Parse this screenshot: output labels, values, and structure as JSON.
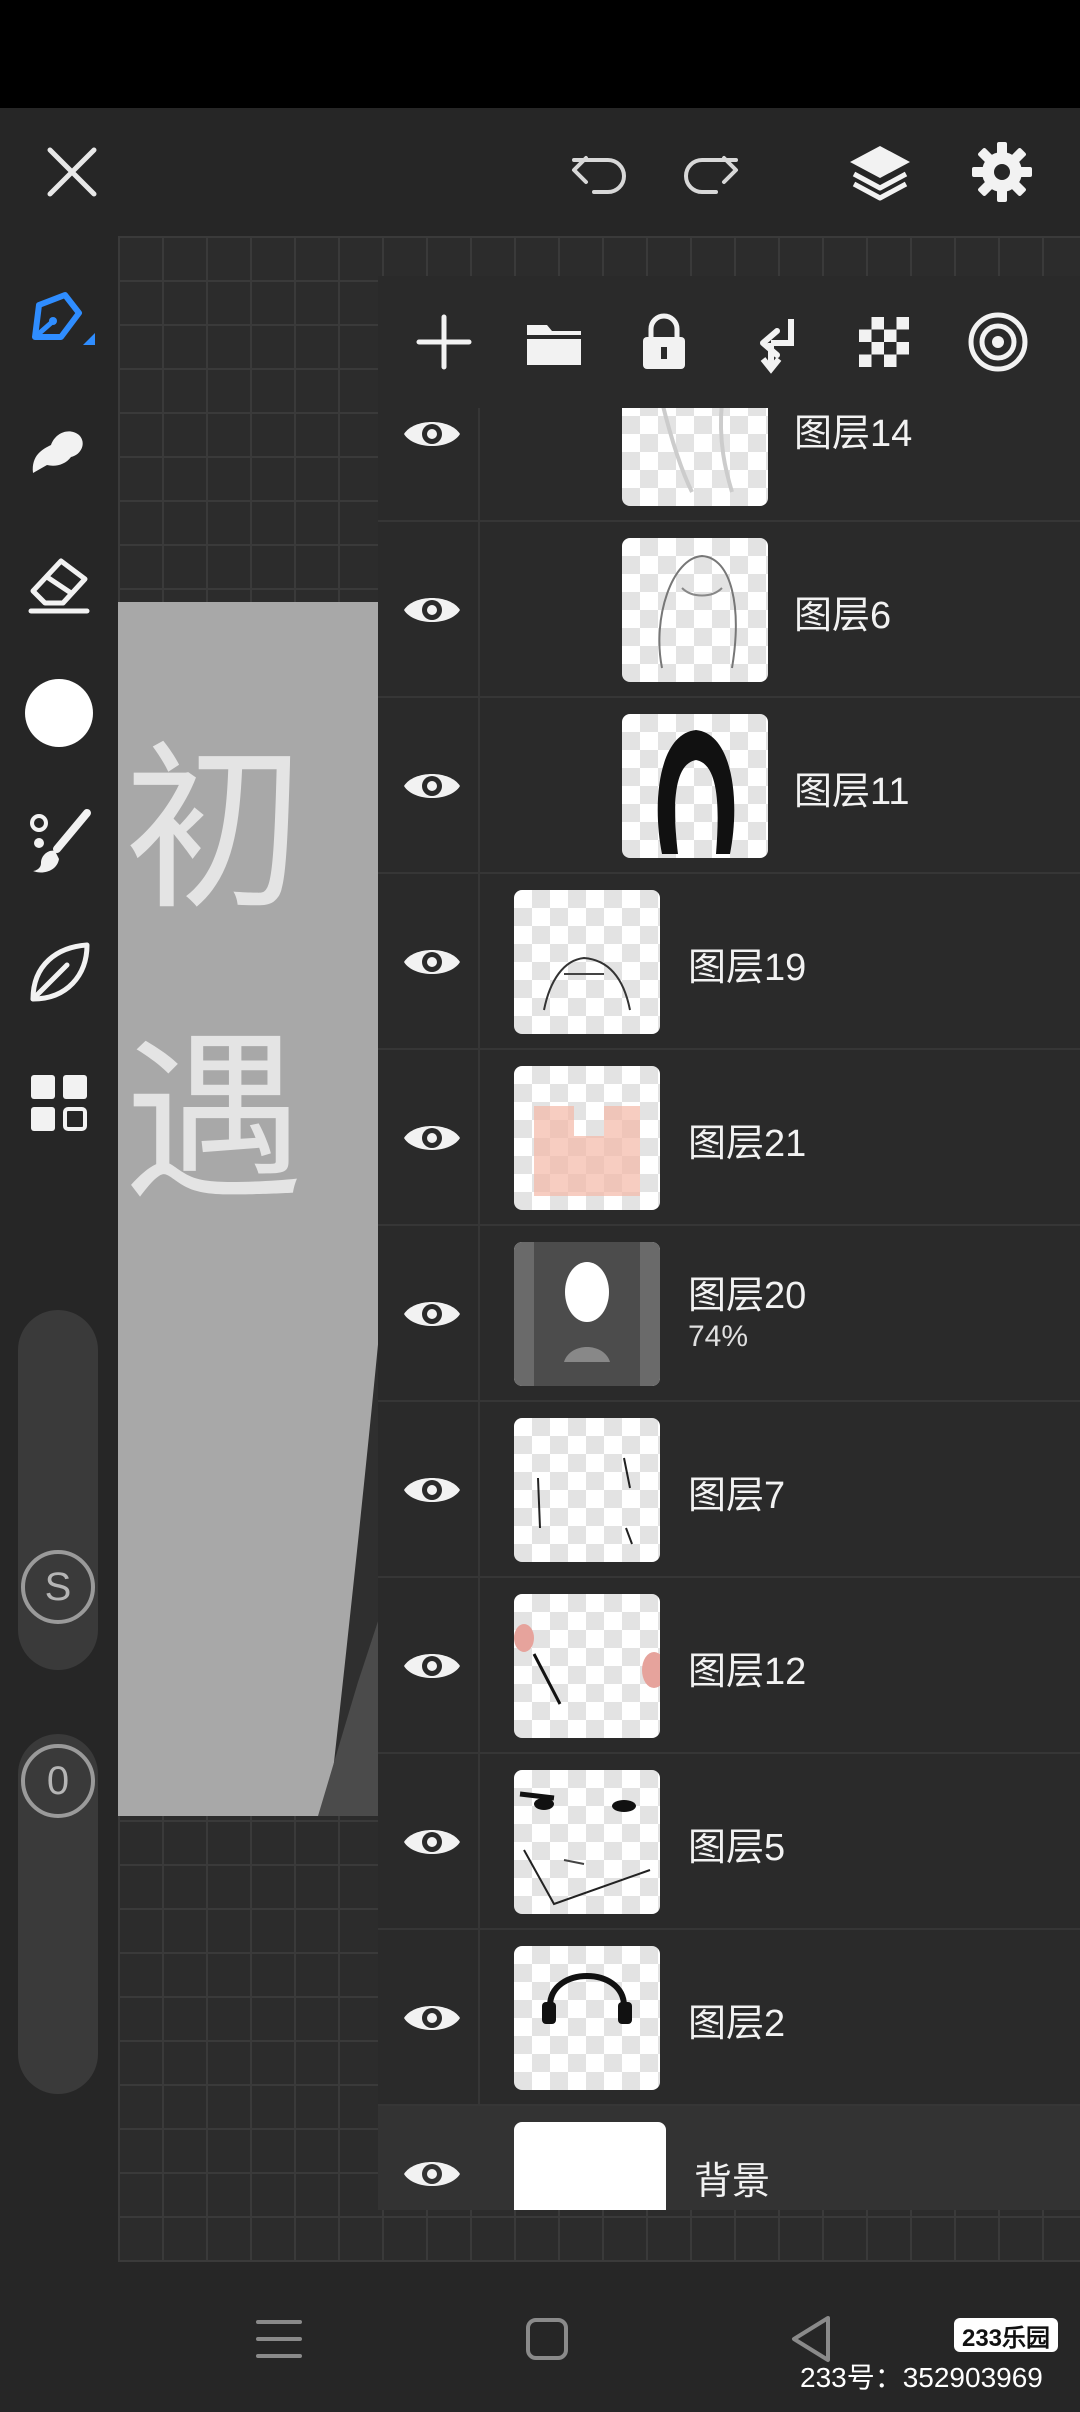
{
  "app": {
    "close_icon": "close-icon",
    "undo_icon": "undo-icon",
    "redo_icon": "redo-icon",
    "layers_icon": "layers-icon",
    "settings_icon": "gear-icon"
  },
  "left_toolbar": {
    "tools": [
      "pen-tool-icon",
      "smudge-tool-icon",
      "eraser-tool-icon",
      "color-picker-icon",
      "brush-settings-icon",
      "leaf-brush-icon",
      "grid-panel-icon"
    ],
    "size_slider_label": "S",
    "opacity_slider_label": "0",
    "accent_color": "#2f8dff"
  },
  "artwork": {
    "title_text": "初遇"
  },
  "layers_toolbar": {
    "icons": [
      "add-layer-icon",
      "folder-icon",
      "lock-icon",
      "merge-down-icon",
      "transparency-icon",
      "radial-icon"
    ]
  },
  "layers": [
    {
      "name": "图层14",
      "opacity": ""
    },
    {
      "name": "图层6",
      "opacity": ""
    },
    {
      "name": "图层11",
      "opacity": ""
    },
    {
      "name": "图层19",
      "opacity": ""
    },
    {
      "name": "图层21",
      "opacity": ""
    },
    {
      "name": "图层20",
      "opacity": "74%"
    },
    {
      "name": "图层7",
      "opacity": ""
    },
    {
      "name": "图层12",
      "opacity": ""
    },
    {
      "name": "图层5",
      "opacity": ""
    },
    {
      "name": "图层2",
      "opacity": ""
    },
    {
      "name": "背景",
      "opacity": ""
    }
  ],
  "nav": {
    "menu_icon": "menu-icon",
    "home_icon": "home-icon",
    "back_icon": "back-icon"
  },
  "watermark": {
    "logo": "233乐园",
    "id": "233号：352903969"
  }
}
